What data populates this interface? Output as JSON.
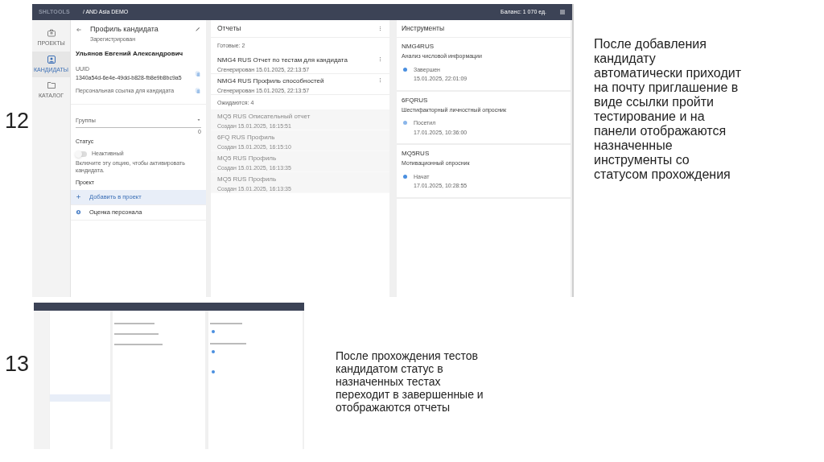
{
  "steps": [
    {
      "number": "12",
      "screen": {
        "header": {
          "logo": "SHLTOOLS",
          "breadcrumb": "/ AND Asia DEMO",
          "balance": "Баланс: 1 070 ед."
        },
        "nav": [
          {
            "label": "ПРОЕКТЫ",
            "kind": "projects",
            "selected": false
          },
          {
            "label": "КАНДИДАТЫ",
            "kind": "candidates",
            "selected": true
          },
          {
            "label": "КАТАЛОГ",
            "kind": "catalog",
            "selected": false
          }
        ],
        "profile": {
          "title": "Профиль кандидата",
          "subtitle": "Зарегистрирован",
          "name": "Ульянов Евгений Александрович",
          "uuid_label": "UUID",
          "uuid": "1340a54d-6e4e-49dd-b828-fb8e9b8bc9a5",
          "link_label": "Персональная ссылка для кандидата",
          "groups_placeholder": "Группы",
          "groups_count": "0",
          "status_label": "Статус",
          "toggle": {
            "on": false,
            "label": "Неактивный"
          },
          "hint": "Включите эту опцию, чтобы активировать кандидата.",
          "project_label": "Проект",
          "actions": [
            {
              "label": "Добавить в проект",
              "kind": "add",
              "selected": true
            },
            {
              "label": "Оценка персонала",
              "kind": "assessment",
              "selected": false
            }
          ]
        },
        "reports": {
          "title": "Отчеты",
          "sections": [
            {
              "label": "Готовые: 2",
              "pending": false,
              "items": [
                {
                  "title": "NMG4 RUS Отчет по тестам для кандидата",
                  "subtitle": "Сгенерирован 15.01.2025, 22:13:57"
                },
                {
                  "title": "NMG4 RUS Профиль способностей",
                  "subtitle": "Сгенерирован 15.01.2025, 22:13:57"
                }
              ]
            },
            {
              "label": "Ожидаются: 4",
              "pending": true,
              "items": [
                {
                  "title": "MQ5 RUS Описательный отчет",
                  "subtitle": "Создан 15.01.2025, 16:15:51"
                },
                {
                  "title": "6FQ RUS Профиль",
                  "subtitle": "Создан 15.01.2025, 16:15:10"
                },
                {
                  "title": "MQ5 RUS Профиль",
                  "subtitle": "Создан 15.01.2025, 16:13:35"
                },
                {
                  "title": "MQ5 RUS Профиль",
                  "subtitle": "Создан 15.01.2025, 16:13:35"
                }
              ]
            }
          ]
        },
        "tools": {
          "title": "Инструменты",
          "items": [
            {
              "code": "NMG4RUS",
              "name": "Анализ числовой информации",
              "status": "Завершен",
              "date": "15.01.2025, 22:01:09",
              "color": "#4a8fe0"
            },
            {
              "code": "6FQRUS",
              "name": "Шестифакторный личностный опросник",
              "status": "Посетил",
              "date": "17.01.2025, 10:36:00",
              "color": "#8ab6ea"
            },
            {
              "code": "MQ5RUS",
              "name": "Мотивационный опросник",
              "status": "Начат",
              "date": "17.01.2025, 10:28:55",
              "color": "#4a8fe0"
            }
          ]
        }
      },
      "caption": "После добавления кандидату автоматически приходит на почту приглашение в виде ссылки пройти тестирование и на панели отображаются назначенные инструменты со статусом прохождения"
    },
    {
      "number": "13",
      "caption": "После прохождения тестов кандидатом статус в назначенных тестах переходит в завершенные и отображаются отчеты"
    }
  ]
}
